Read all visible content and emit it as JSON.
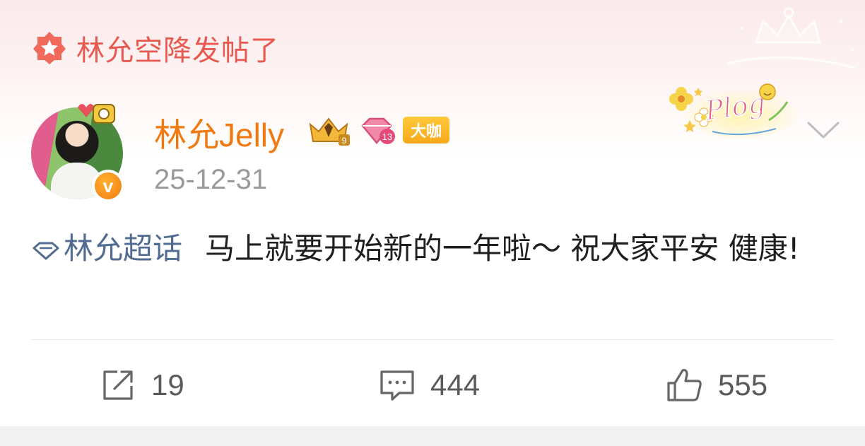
{
  "banner": {
    "icon": "star-medal-icon",
    "text": "林允空降发帖了"
  },
  "post": {
    "author": {
      "name": "林允Jelly",
      "avatar_icon": "avatar-icon",
      "verified_icon": "verified-v-icon",
      "badge_label": "大咖"
    },
    "date": "25-12-31",
    "topic": {
      "icon": "super-topic-diamond-icon",
      "label": "林允超话"
    },
    "body": "马上就要开始新的一年啦～ 祝大家平安 健康!",
    "sticker_icon": "plog-sticker-icon"
  },
  "actions": {
    "repost": {
      "icon": "repost-icon",
      "count": "19"
    },
    "comment": {
      "icon": "comment-icon",
      "count": "444"
    },
    "like": {
      "icon": "thumbs-up-icon",
      "count": "555"
    }
  },
  "colors": {
    "banner": "#e85a50",
    "username": "#ef7a12",
    "topic": "#516b91",
    "badge": "#f6a91a"
  }
}
